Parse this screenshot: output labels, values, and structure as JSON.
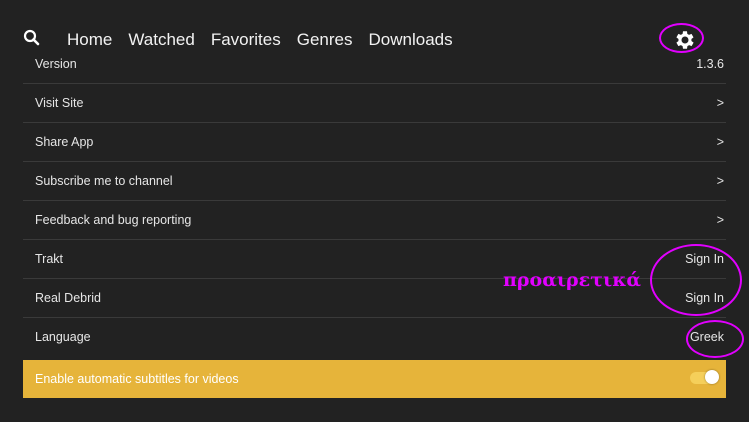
{
  "nav": {
    "search_icon": "search-icon",
    "items": [
      "Home",
      "Watched",
      "Favorites",
      "Genres",
      "Downloads"
    ],
    "settings_icon": "gear-icon"
  },
  "settings": {
    "rows": [
      {
        "label": "Version",
        "value": "1.3.6"
      },
      {
        "label": "Visit Site",
        "value": ">"
      },
      {
        "label": "Share App",
        "value": ">"
      },
      {
        "label": "Subscribe me to channel",
        "value": ">"
      },
      {
        "label": "Feedback and bug reporting",
        "value": ">"
      },
      {
        "label": "Trakt",
        "value": "Sign In"
      },
      {
        "label": "Real Debrid",
        "value": "Sign In"
      },
      {
        "label": "Language",
        "value": "Greek"
      }
    ],
    "subtitles": {
      "label": "Enable automatic subtitles for videos",
      "enabled": true
    }
  },
  "annotation": {
    "text": "προαιρετικά",
    "color": "#e100ff"
  },
  "colors": {
    "background": "#222222",
    "highlight": "#e6b43a",
    "annotation": "#e100ff"
  }
}
